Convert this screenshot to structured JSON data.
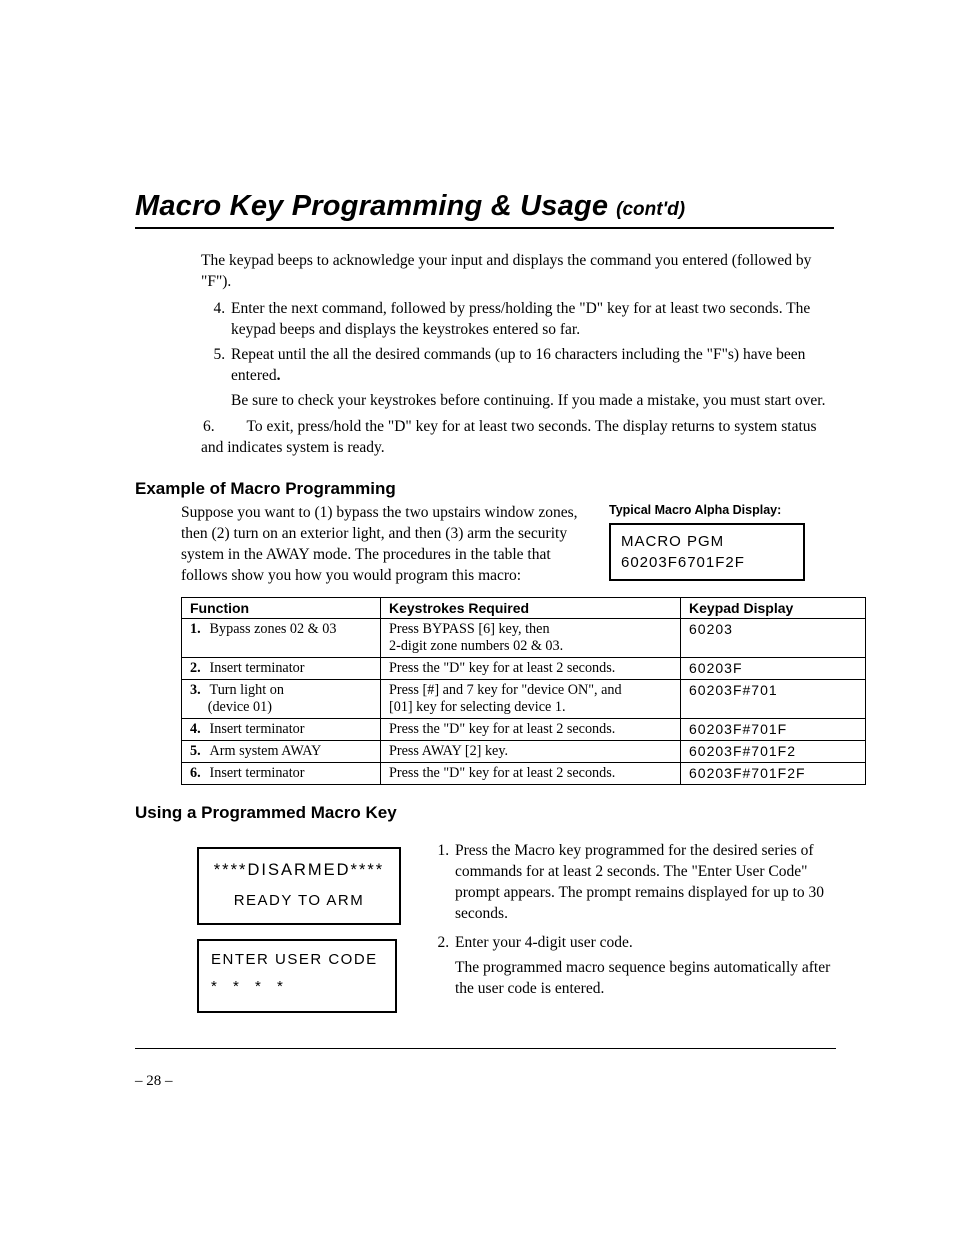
{
  "title": {
    "main": "Macro Key Programming & Usage",
    "cont": "(cont'd)"
  },
  "intro_para": "The keypad beeps to acknowledge your input and displays the command you entered (followed by \"F\").",
  "steps": {
    "s4": "Enter the next command, followed by press/holding the \"D\" key for at least two seconds. The keypad beeps and displays the keystrokes entered so far.",
    "s5_a": "Repeat until the all the desired commands (up to 16 characters including the \"F\"s) have been entered",
    "s5_dot": ".",
    "s5_follow": "Be sure to check your keystrokes before continuing. If you made a mistake, you must start over.",
    "s6_num": "6.",
    "s6_text": "To exit, press/hold the \"D\" key for at least two seconds. The display returns to system status and indicates system is ready."
  },
  "example": {
    "heading": "Example of Macro Programming",
    "para": "Suppose you want to (1) bypass the two upstairs window zones, then (2) turn on an exterior light, and then (3) arm the security system in the AWAY mode. The procedures in the table that follows show you how you would program this macro:",
    "typical_label": "Typical Macro Alpha Display:",
    "lcd1": "MACRO PGM",
    "lcd2": "60203F6701F2F"
  },
  "table": {
    "h1": "Function",
    "h2": "Keystrokes Required",
    "h3": "Keypad Display",
    "rows": [
      {
        "n": "1.",
        "fn": "Bypass zones 02 & 03",
        "ks1": "Press BYPASS [6] key, then",
        "ks2": "2-digit zone numbers 02 & 03.",
        "disp": "60203"
      },
      {
        "n": "2.",
        "fn": "Insert terminator",
        "ks1": "Press the \"D\" key for at least 2 seconds.",
        "ks2": "",
        "disp": "60203F"
      },
      {
        "n": "3.",
        "fn": "Turn light on",
        "fn2": "(device 01)",
        "ks1": "Press [#] and 7 key for \"device ON\", and",
        "ks2": "[01] key for selecting device 1.",
        "disp": "60203F#701"
      },
      {
        "n": "4.",
        "fn": "Insert terminator",
        "ks1": "Press the \"D\" key for at least 2 seconds.",
        "ks2": "",
        "disp": "60203F#701F"
      },
      {
        "n": "5.",
        "fn": "Arm system AWAY",
        "ks1": "Press AWAY [2] key.",
        "ks2": "",
        "disp": "60203F#701F2"
      },
      {
        "n": "6.",
        "fn": "Insert terminator",
        "ks1": "Press the \"D\" key for at least 2 seconds.",
        "ks2": "",
        "disp": "60203F#701F2F"
      }
    ]
  },
  "using": {
    "heading": "Using a Programmed Macro Key",
    "lcd_dis_1": "****DISARMED****",
    "lcd_dis_2": "READY TO ARM",
    "lcd_enter_1": "ENTER USER CODE",
    "lcd_enter_2": "* * * *",
    "step1": "Press the Macro key programmed for the desired series of commands for at least 2 seconds. The \"Enter User Code\" prompt appears. The prompt remains displayed for up to 30 seconds.",
    "step2": "Enter your 4-digit user code.",
    "step2_follow": "The programmed macro sequence begins automatically after the user code is entered."
  },
  "page_number": "– 28 –"
}
